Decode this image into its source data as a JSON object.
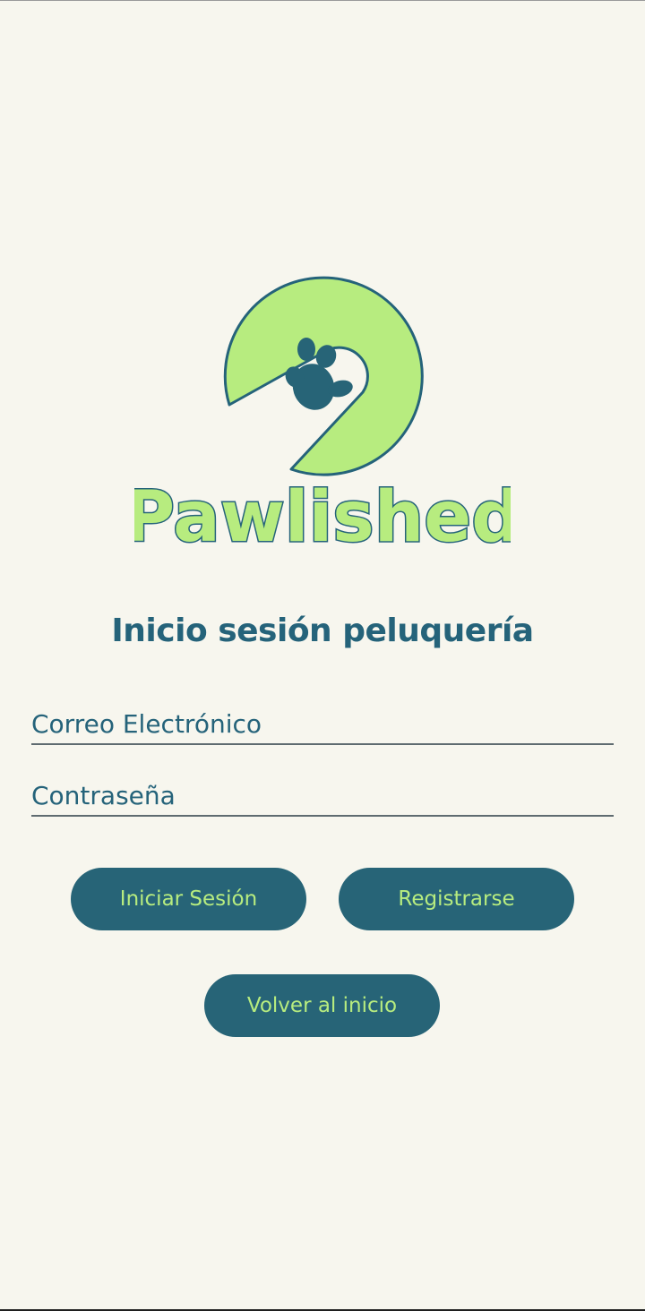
{
  "app": {
    "brand_name": "Pawlished"
  },
  "colors": {
    "background": "#f7f6ee",
    "primary": "#276477",
    "accent": "#b7ec7f",
    "text": "#25637a"
  },
  "logo": {
    "icon": "paw-icon"
  },
  "page_title": "Inicio sesión peluquería",
  "form": {
    "email_placeholder": "Correo Electrónico",
    "email_value": "",
    "password_placeholder": "Contraseña",
    "password_value": ""
  },
  "buttons": {
    "login_label": "Iniciar Sesión",
    "register_label": "Registrarse",
    "back_label": "Volver al inicio"
  }
}
